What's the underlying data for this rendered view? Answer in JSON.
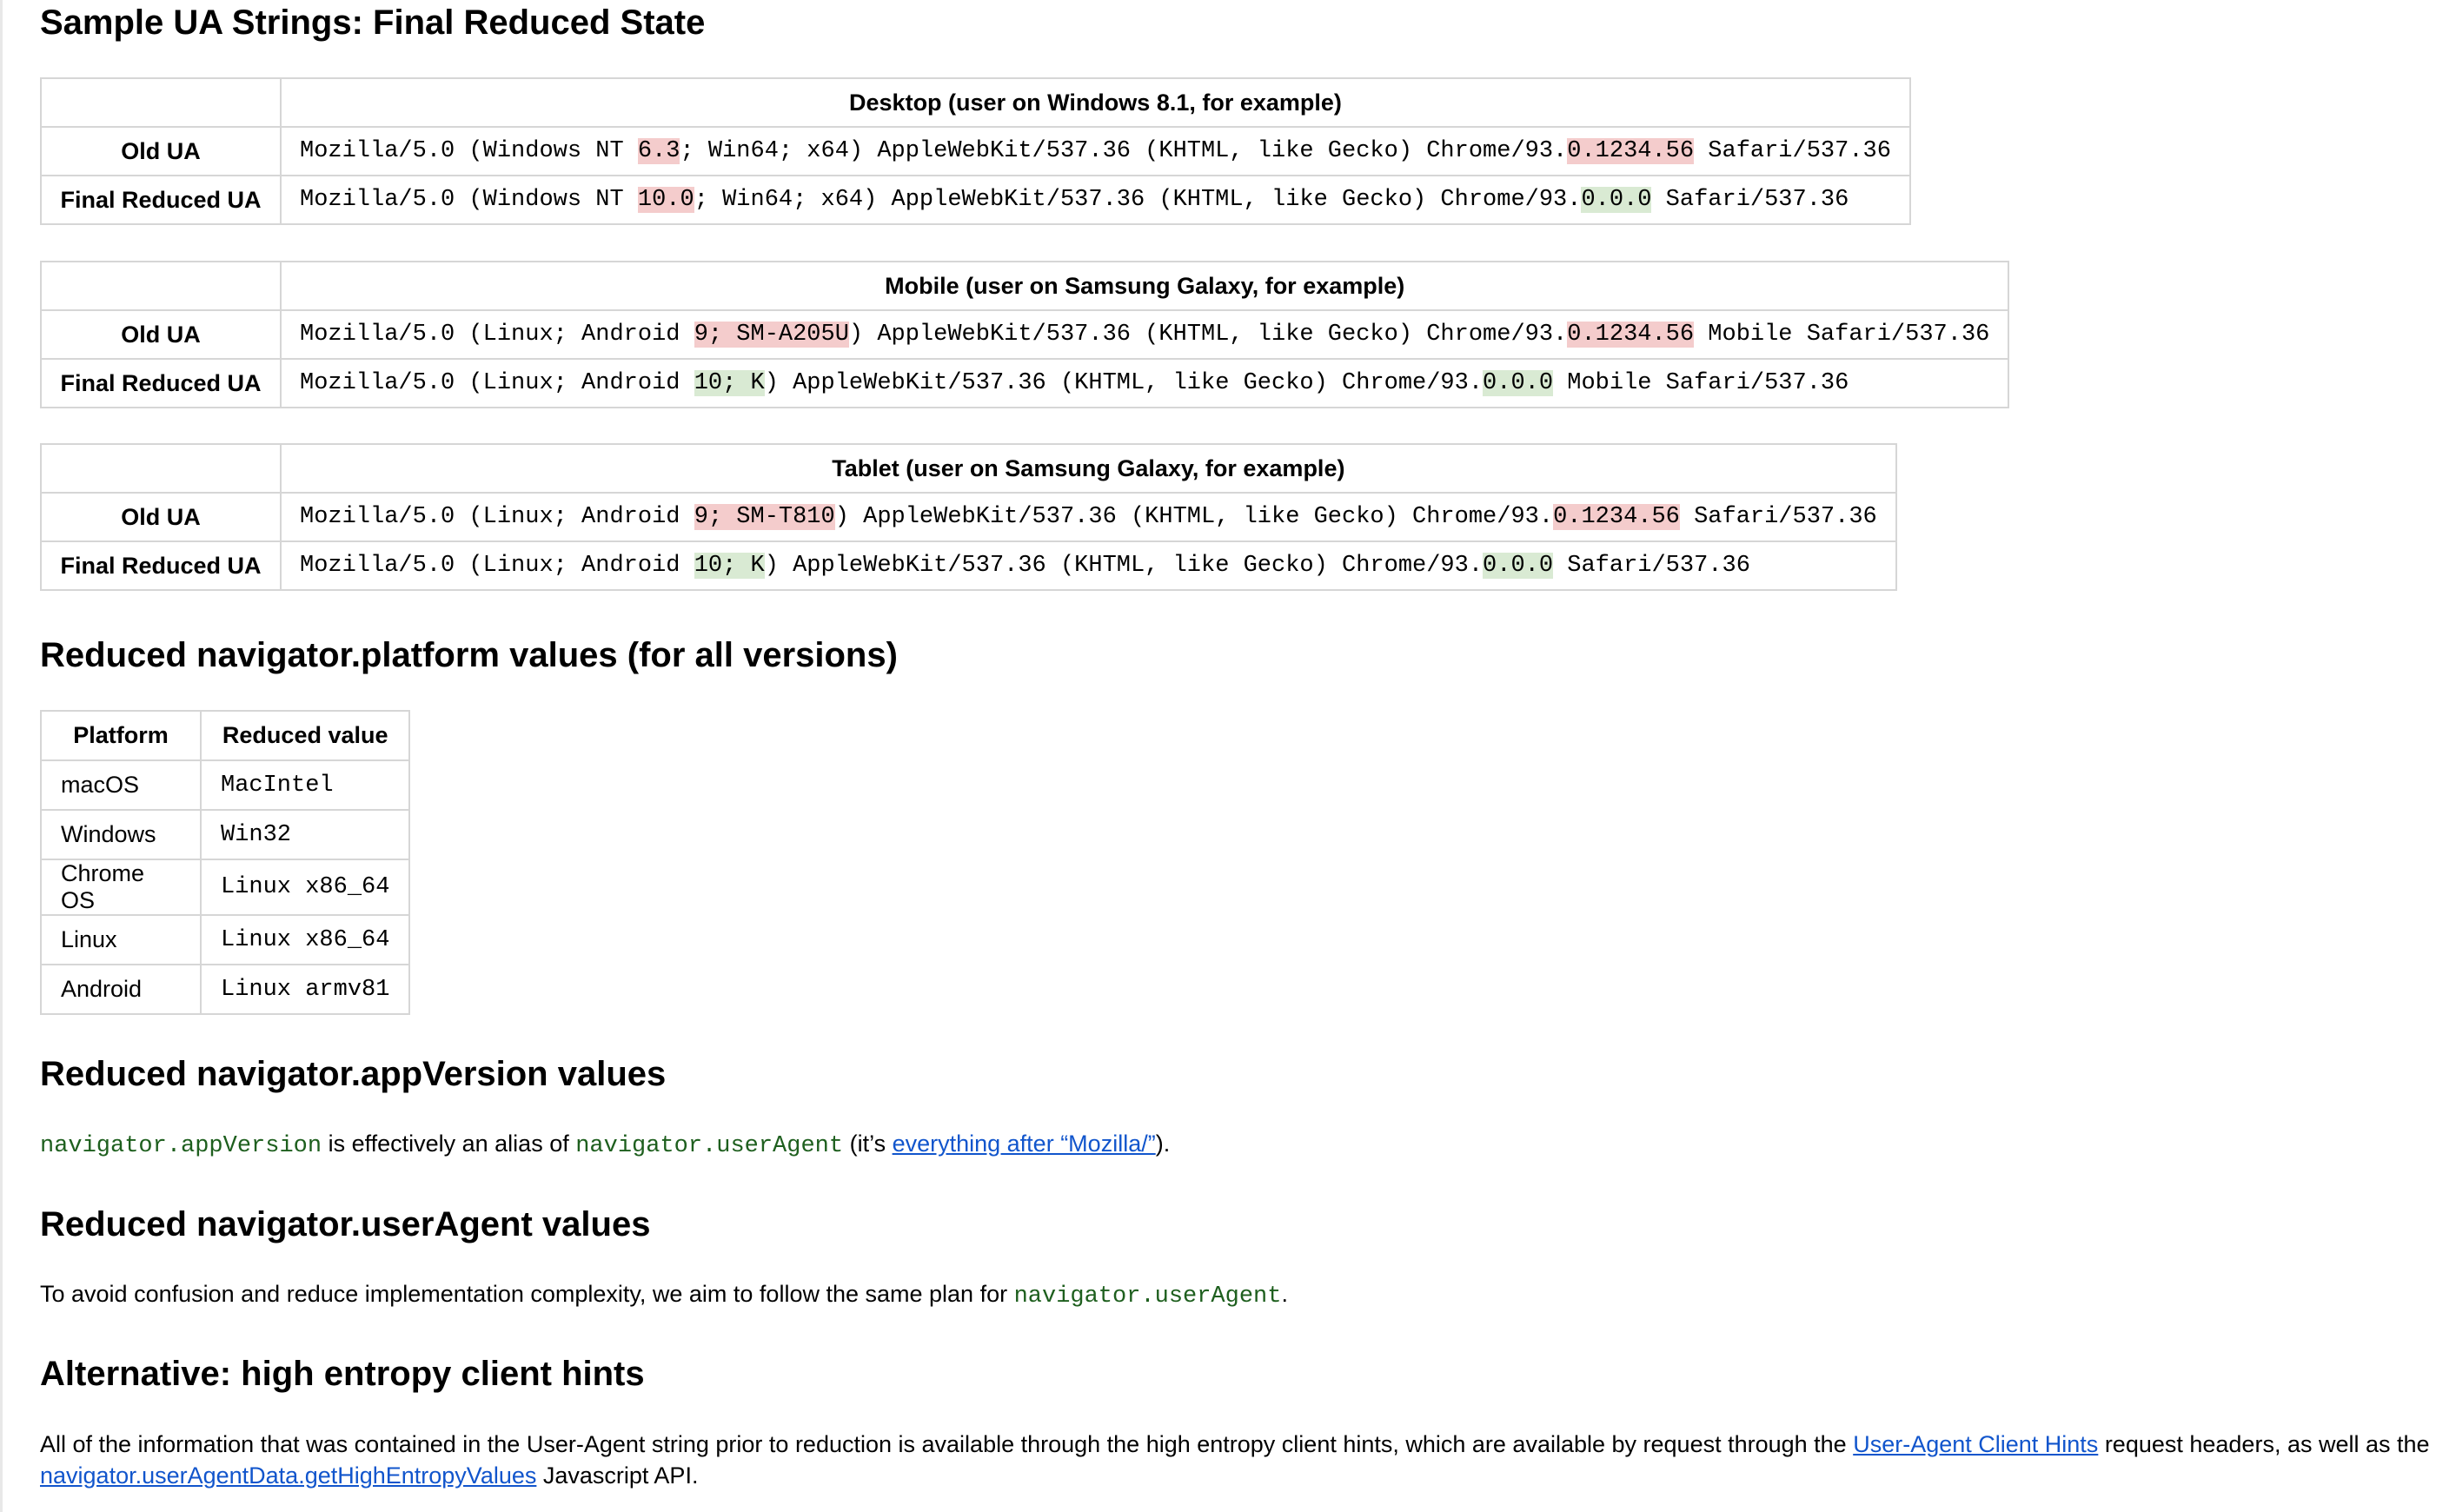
{
  "title": "Sample UA Strings: Final Reduced State",
  "ua_tables": [
    {
      "heading": "Desktop (user on Windows 8.1, for example)",
      "rows": [
        {
          "label": "Old UA",
          "parts": [
            {
              "text": "Mozilla/5.0 (Windows NT ",
              "hl": ""
            },
            {
              "text": "6.3",
              "hl": "red"
            },
            {
              "text": "; Win64; x64) AppleWebKit/537.36 (KHTML, like Gecko) Chrome/93.",
              "hl": ""
            },
            {
              "text": "0.1234.56",
              "hl": "red"
            },
            {
              "text": " Safari/537.36",
              "hl": ""
            }
          ]
        },
        {
          "label": "Final Reduced UA",
          "parts": [
            {
              "text": "Mozilla/5.0 (Windows NT ",
              "hl": ""
            },
            {
              "text": "10.0",
              "hl": "red"
            },
            {
              "text": "; Win64; x64) AppleWebKit/537.36 (KHTML, like Gecko) Chrome/93.",
              "hl": ""
            },
            {
              "text": "0.0.0",
              "hl": "green"
            },
            {
              "text": " Safari/537.36",
              "hl": ""
            }
          ]
        }
      ]
    },
    {
      "heading": "Mobile (user on Samsung Galaxy, for example)",
      "rows": [
        {
          "label": "Old UA",
          "parts": [
            {
              "text": "Mozilla/5.0 (Linux; Android ",
              "hl": ""
            },
            {
              "text": "9; SM-A205U",
              "hl": "red"
            },
            {
              "text": ") AppleWebKit/537.36 (KHTML, like Gecko) Chrome/93.",
              "hl": ""
            },
            {
              "text": "0.1234.56",
              "hl": "red"
            },
            {
              "text": " Mobile Safari/537.36",
              "hl": ""
            }
          ]
        },
        {
          "label": "Final Reduced UA",
          "parts": [
            {
              "text": "Mozilla/5.0 (Linux; Android ",
              "hl": ""
            },
            {
              "text": "10; K",
              "hl": "green"
            },
            {
              "text": ") AppleWebKit/537.36 (KHTML, like Gecko) Chrome/93.",
              "hl": ""
            },
            {
              "text": "0.0.0",
              "hl": "green"
            },
            {
              "text": " Mobile Safari/537.36",
              "hl": ""
            }
          ]
        }
      ]
    },
    {
      "heading": "Tablet (user on Samsung Galaxy, for example)",
      "rows": [
        {
          "label": "Old UA",
          "parts": [
            {
              "text": "Mozilla/5.0 (Linux; Android ",
              "hl": ""
            },
            {
              "text": "9; SM-T810",
              "hl": "red"
            },
            {
              "text": ") AppleWebKit/537.36 (KHTML, like Gecko) Chrome/93.",
              "hl": ""
            },
            {
              "text": "0.1234.56",
              "hl": "red"
            },
            {
              "text": " Safari/537.36",
              "hl": ""
            }
          ]
        },
        {
          "label": "Final Reduced UA",
          "parts": [
            {
              "text": "Mozilla/5.0 (Linux; Android ",
              "hl": ""
            },
            {
              "text": "10; K",
              "hl": "green"
            },
            {
              "text": ") AppleWebKit/537.36 (KHTML, like Gecko) Chrome/93.",
              "hl": ""
            },
            {
              "text": "0.0.0",
              "hl": "green"
            },
            {
              "text": " Safari/537.36",
              "hl": ""
            }
          ]
        }
      ]
    }
  ],
  "platform_section": {
    "heading": "Reduced navigator.platform values (for all versions)",
    "col_platform": "Platform",
    "col_value": "Reduced value",
    "rows": [
      {
        "platform": "macOS",
        "value": "MacIntel"
      },
      {
        "platform": "Windows",
        "value": "Win32"
      },
      {
        "platform": "Chrome OS",
        "value": "Linux x86_64"
      },
      {
        "platform": "Linux",
        "value": "Linux x86_64"
      },
      {
        "platform": "Android",
        "value": "Linux armv81"
      }
    ]
  },
  "appversion_section": {
    "heading": "Reduced navigator.appVersion values",
    "code1": "navigator.appVersion",
    "text1": " is effectively an alias of ",
    "code2": "navigator.userAgent",
    "text2": " (it’s ",
    "link": "everything after “Mozilla/”",
    "text3": ")."
  },
  "useragent_section": {
    "heading": "Reduced navigator.userAgent values",
    "text1": "To avoid confusion and reduce implementation complexity, we aim to follow the same plan for ",
    "code": "navigator.userAgent",
    "text2": "."
  },
  "hints_section": {
    "heading": "Alternative: high entropy client hints",
    "text1": "All of the information that was contained in the User-Agent string prior to reduction is available through the high entropy client hints, which are available by request through the ",
    "link1": "User-Agent Client Hints",
    "text2": " request headers, as well as the ",
    "link2": "navigator.userAgentData.getHighEntropyValues",
    "text3": " Javascript API."
  },
  "colors": {
    "highlight_red": "#f4cccc",
    "highlight_green": "#d9ead3",
    "code_green": "#1e5f1e",
    "link_blue": "#1155cc",
    "border": "#d6d6d6"
  }
}
